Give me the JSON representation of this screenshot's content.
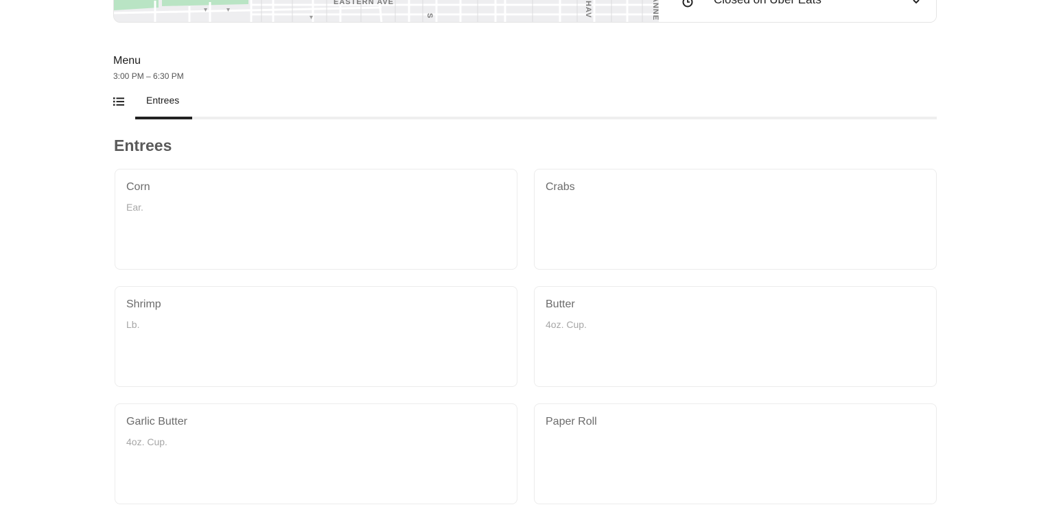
{
  "store": {
    "map": {
      "street_labels": [
        "EASTERN AVE",
        "S",
        "HAV",
        "ANNE"
      ]
    },
    "hours_status": "Closed on Uber Eats"
  },
  "menu": {
    "title": "Menu",
    "hours": "3:00 PM – 6:30 PM",
    "tabs": [
      {
        "label": "Entrees",
        "active": true
      }
    ]
  },
  "section": {
    "title": "Entrees",
    "items": [
      {
        "name": "Corn",
        "description": "Ear."
      },
      {
        "name": "Crabs",
        "description": ""
      },
      {
        "name": "Shrimp",
        "description": "Lb."
      },
      {
        "name": "Butter",
        "description": "4oz. Cup."
      },
      {
        "name": "Garlic Butter",
        "description": "4oz. Cup."
      },
      {
        "name": "Paper Roll",
        "description": ""
      }
    ]
  },
  "colors": {
    "map_park": "#b9e4c4",
    "map_background": "#eeeef0",
    "active_tab": "#222222"
  }
}
